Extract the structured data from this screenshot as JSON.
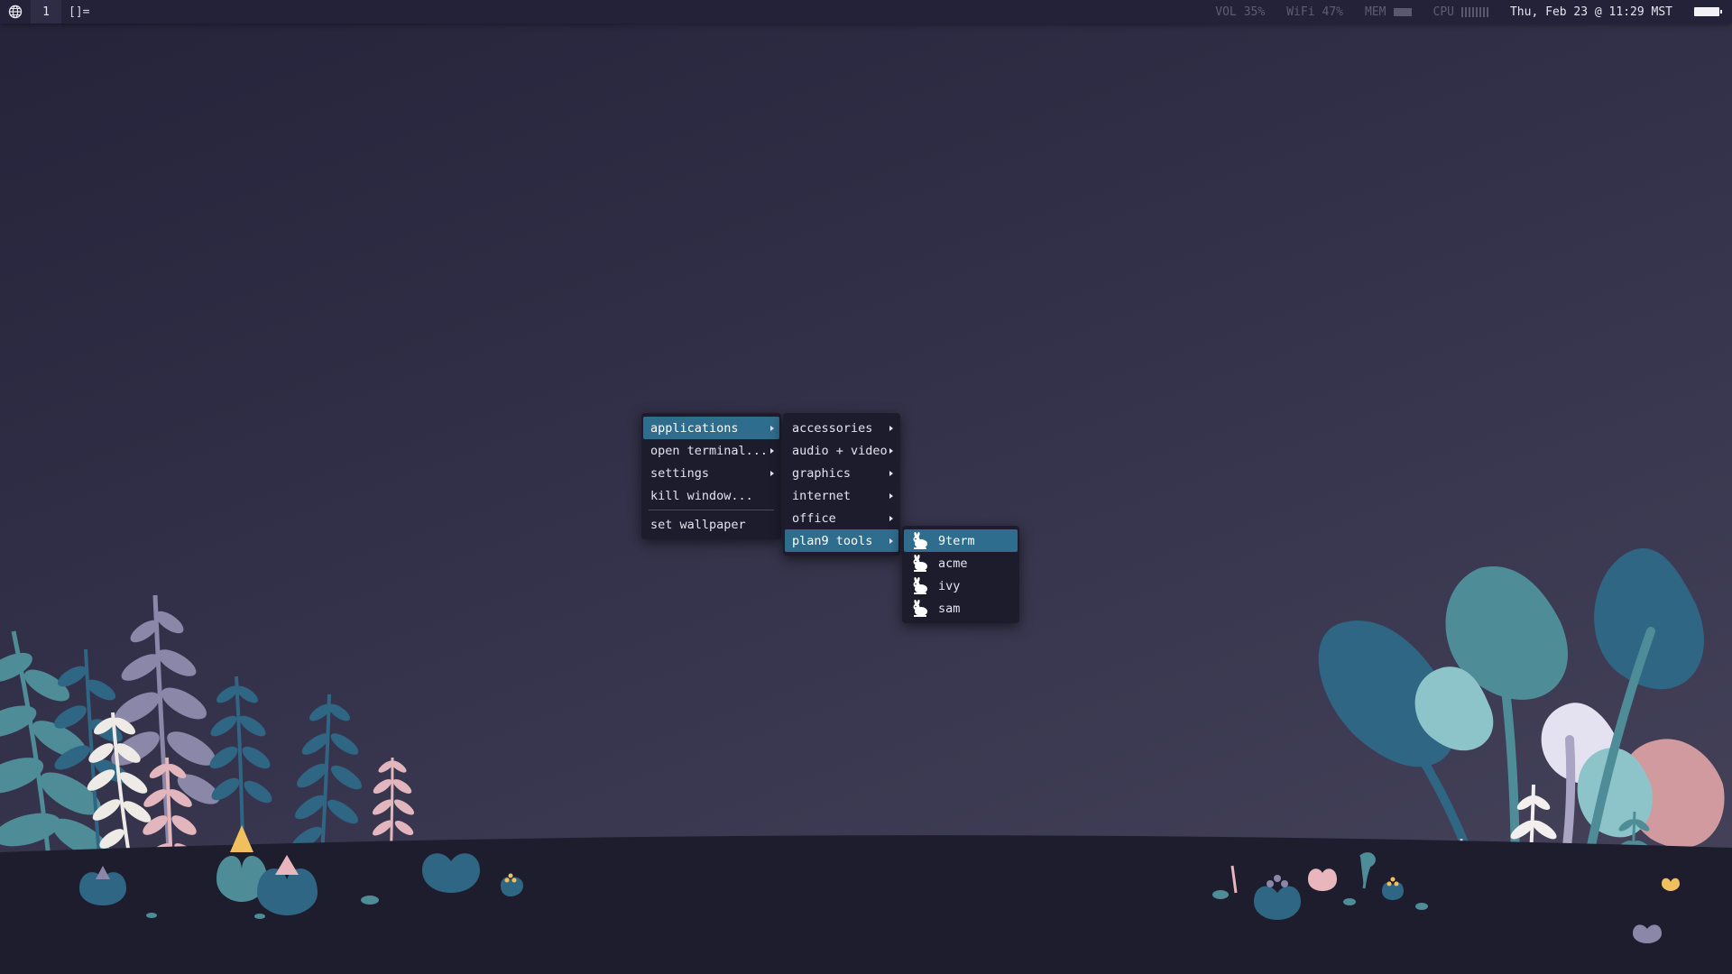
{
  "topbar": {
    "tag": "1",
    "layout": "[]=",
    "vol_label": "VOL",
    "vol_value": "35%",
    "wifi_label": "WiFi",
    "wifi_value": "47%",
    "mem_label": "MEM",
    "cpu_label": "CPU",
    "clock": "Thu, Feb 23 @ 11:29 MST"
  },
  "menus": {
    "main": [
      {
        "label": "applications",
        "submenu": true,
        "active": true
      },
      {
        "label": "open terminal...",
        "submenu": true,
        "active": false
      },
      {
        "label": "settings",
        "submenu": true,
        "active": false
      },
      {
        "label": "kill window...",
        "submenu": false,
        "active": false
      },
      {
        "label": "set wallpaper",
        "submenu": false,
        "active": false
      }
    ],
    "applications": [
      {
        "label": "accessories",
        "submenu": true,
        "active": false
      },
      {
        "label": "audio + video",
        "submenu": true,
        "active": false
      },
      {
        "label": "graphics",
        "submenu": true,
        "active": false
      },
      {
        "label": "internet",
        "submenu": true,
        "active": false
      },
      {
        "label": "office",
        "submenu": true,
        "active": false
      },
      {
        "label": "plan9 tools",
        "submenu": true,
        "active": true
      }
    ],
    "plan9": [
      {
        "label": "9term",
        "icon": "glenda-rabbit-icon",
        "active": true
      },
      {
        "label": "acme",
        "icon": "glenda-rabbit-icon",
        "active": false
      },
      {
        "label": "ivy",
        "icon": "glenda-rabbit-icon",
        "active": false
      },
      {
        "label": "sam",
        "icon": "glenda-rabbit-icon",
        "active": false
      }
    ]
  },
  "colors": {
    "bar_bg": "#232238",
    "menu_bg": "#1d1c2d",
    "accent": "#2f6d8f",
    "ground": "#1e1d2e"
  }
}
